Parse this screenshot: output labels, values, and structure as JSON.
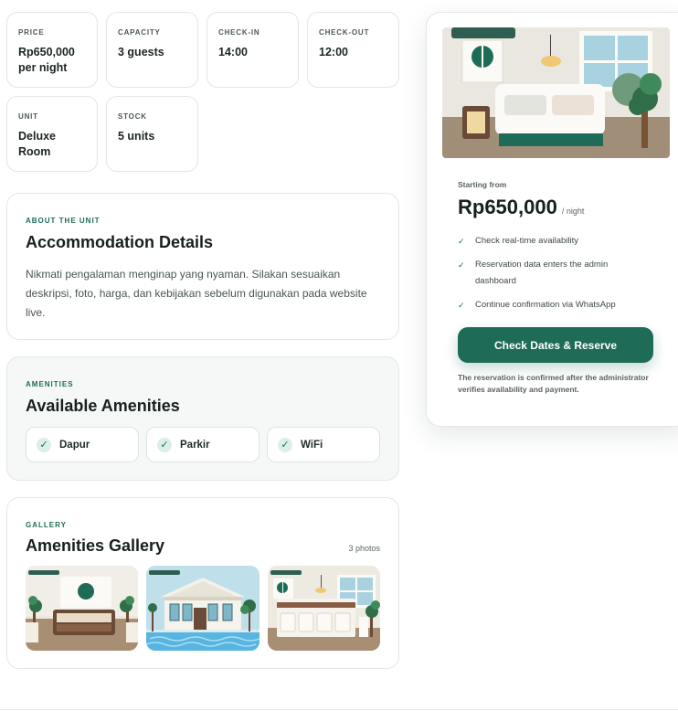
{
  "stats": [
    {
      "label": "PRICE",
      "value": "Rp650,000 per night"
    },
    {
      "label": "CAPACITY",
      "value": "3 guests"
    },
    {
      "label": "CHECK-IN",
      "value": "14:00"
    },
    {
      "label": "CHECK-OUT",
      "value": "12:00"
    },
    {
      "label": "UNIT",
      "value": "Deluxe Room"
    },
    {
      "label": "STOCK",
      "value": "5 units"
    }
  ],
  "about": {
    "eyebrow": "ABOUT THE UNIT",
    "title": "Accommodation Details",
    "description": "Nikmati pengalaman menginap yang nyaman. Silakan sesuaikan deskripsi, foto, harga, dan kebijakan sebelum digunakan pada website live."
  },
  "amenities": {
    "eyebrow": "AMENITIES",
    "title": "Available Amenities",
    "items": [
      "Dapur",
      "Parkir",
      "WiFi"
    ]
  },
  "gallery": {
    "eyebrow": "GALLERY",
    "title": "Amenities Gallery",
    "count": "3 photos"
  },
  "booking": {
    "starting_label": "Starting from",
    "price": "Rp650,000",
    "per": "/ night",
    "features": [
      "Check real-time availability",
      "Reservation data enters the admin dashboard",
      "Continue confirmation via WhatsApp"
    ],
    "cta_label": "Check Dates & Reserve",
    "note": "The reservation is confirmed after the administrator verifies availability and payment."
  },
  "colors": {
    "accent": "#1e6b57",
    "accent_light": "#dcefe6",
    "border": "#e3e7e5",
    "amenities_bg": "#f5f8f7"
  },
  "icons": {
    "check": "check-icon"
  }
}
